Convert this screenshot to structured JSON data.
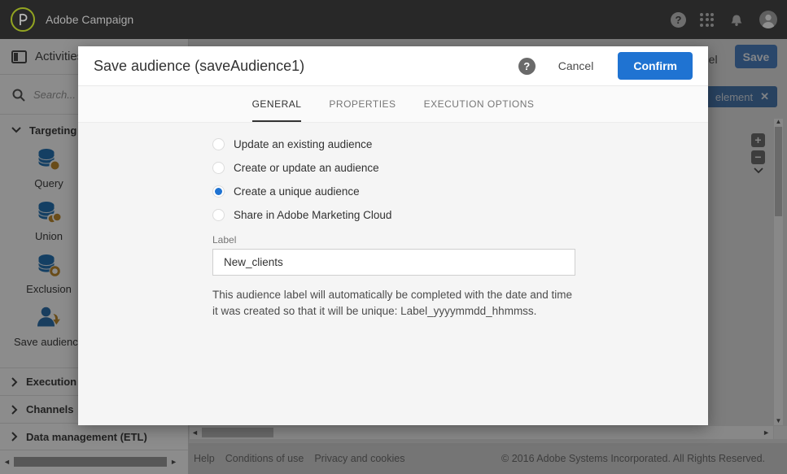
{
  "topbar": {
    "app_title": "Adobe Campaign",
    "icon_names": [
      "adobe-campaign-logo",
      "help-circle-icon",
      "app-grid-icon",
      "bell-icon",
      "user-avatar"
    ]
  },
  "sidebar": {
    "title": "Activities",
    "search_placeholder": "Search...",
    "sections": [
      {
        "label": "Targeting",
        "expanded": true
      },
      {
        "label": "Execution",
        "expanded": false
      },
      {
        "label": "Channels",
        "expanded": false
      },
      {
        "label": "Data management (ETL)",
        "expanded": false
      }
    ],
    "tools": [
      {
        "label": "Query",
        "icon": "database-query-icon"
      },
      {
        "label": "Union",
        "icon": "database-union-icon"
      },
      {
        "label": "Exclusion",
        "icon": "database-exclusion-icon"
      },
      {
        "label": "Save audience",
        "icon": "save-audience-icon"
      }
    ]
  },
  "background_page": {
    "cancel_label": "Cancel",
    "save_label": "Save",
    "element_badge": {
      "label": "element",
      "close_icon": "✕"
    },
    "zoom_in": "+",
    "zoom_out": "−"
  },
  "modal": {
    "title": "Save audience (saveAudience1)",
    "help_icon": "?",
    "cancel_label": "Cancel",
    "confirm_label": "Confirm",
    "tabs": [
      "GENERAL",
      "PROPERTIES",
      "EXECUTION OPTIONS"
    ],
    "active_tab": "GENERAL",
    "radios": [
      {
        "label": "Update an existing audience",
        "selected": false
      },
      {
        "label": "Create or update an audience",
        "selected": false
      },
      {
        "label": "Create a unique audience",
        "selected": true
      },
      {
        "label": "Share in Adobe Marketing Cloud",
        "selected": false
      }
    ],
    "label_field": {
      "label": "Label",
      "value": "New_clients"
    },
    "help_text": "This audience label will automatically be completed with the date and time it was created so that it will be unique: Label_yyyymmdd_hhmmss."
  },
  "footer": {
    "links": [
      "Help",
      "Conditions of use",
      "Privacy and cookies"
    ],
    "copyright": "© 2016 Adobe Systems Incorporated. All Rights Reserved."
  },
  "colors": {
    "accent_blue": "#1f73d2",
    "db_icon_blue": "#2574b5",
    "icon_gold": "#c08a2f",
    "topbar_bg": "#282828"
  }
}
